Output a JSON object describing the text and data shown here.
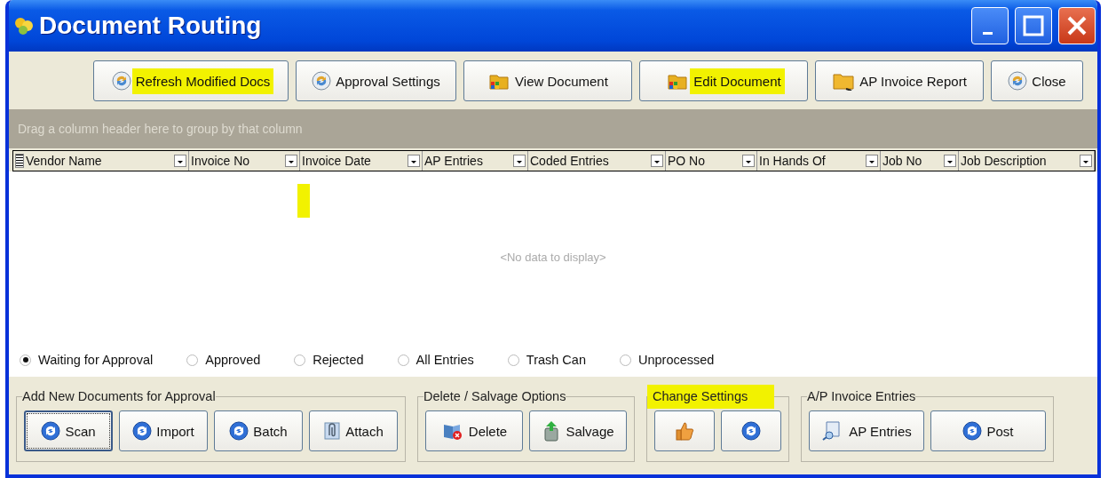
{
  "window": {
    "title": "Document Routing"
  },
  "toolbar": [
    {
      "label": "Refresh Modified Docs",
      "kind": "refresh",
      "highlighted": true
    },
    {
      "label": "Approval Settings",
      "kind": "refresh",
      "highlighted": false
    },
    {
      "label": "View Document",
      "kind": "colorfolder",
      "highlighted": false
    },
    {
      "label": "Edit Document",
      "kind": "colorfolder",
      "highlighted": true
    },
    {
      "label": "AP Invoice Report",
      "kind": "folder",
      "highlighted": false
    },
    {
      "label": "Close",
      "kind": "refresh",
      "highlighted": false
    }
  ],
  "grid": {
    "group_hint": "Drag a column header here to group by that column",
    "columns": [
      "Vendor Name",
      "Invoice No",
      "Invoice Date",
      "AP Entries",
      "Coded Entries",
      "PO No",
      "In Hands Of",
      "Job No",
      "Job Description"
    ],
    "empty_text": "<No data to display>",
    "highlight_mark": true
  },
  "filters": [
    {
      "label": "Waiting for Approval",
      "selected": true
    },
    {
      "label": "Approved",
      "selected": false
    },
    {
      "label": "Rejected",
      "selected": false
    },
    {
      "label": "All Entries",
      "selected": false
    },
    {
      "label": "Trash Can",
      "selected": false
    },
    {
      "label": "Unprocessed",
      "selected": false
    }
  ],
  "groups": [
    {
      "title": "Add New Documents for Approval",
      "highlighted": false,
      "buttons": [
        {
          "label": "Scan",
          "kind": "bluerefresh",
          "focused": true
        },
        {
          "label": "Import",
          "kind": "bluerefresh",
          "focused": false
        },
        {
          "label": "Batch",
          "kind": "bluerefresh",
          "focused": false
        },
        {
          "label": "Attach",
          "kind": "clip",
          "focused": false
        }
      ]
    },
    {
      "title": "Delete / Salvage Options",
      "highlighted": false,
      "buttons": [
        {
          "label": "Delete",
          "kind": "delete",
          "focused": false
        },
        {
          "label": "Salvage",
          "kind": "bin",
          "focused": false
        }
      ]
    },
    {
      "title": "Change Settings",
      "highlighted": true,
      "buttons": [
        {
          "kind": "thumb",
          "focused": false
        },
        {
          "kind": "bluerefresh",
          "focused": false
        }
      ]
    },
    {
      "title": "A/P Invoice Entries",
      "highlighted": false,
      "buttons": [
        {
          "label": "AP Entries",
          "kind": "doc",
          "focused": false
        },
        {
          "label": "Post",
          "kind": "bluerefresh",
          "focused": false
        }
      ]
    }
  ]
}
